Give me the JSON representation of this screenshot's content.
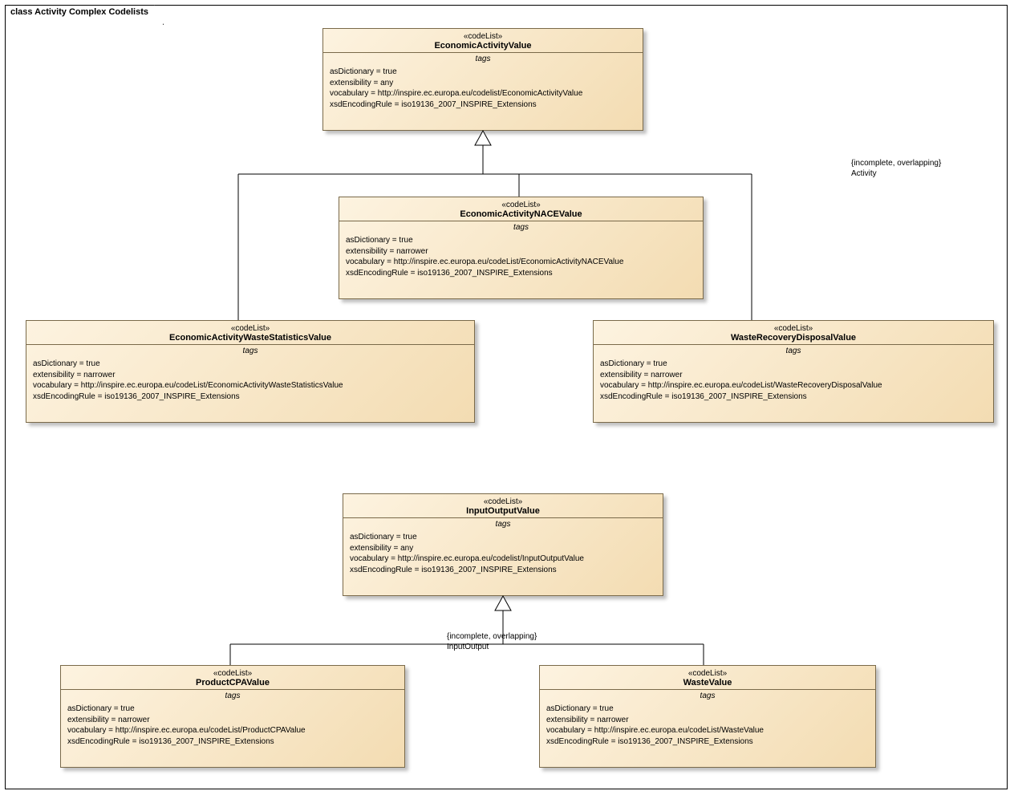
{
  "frame": {
    "title": "class Activity Complex Codelists"
  },
  "notes": {
    "top": {
      "line1": "{incomplete, overlapping}",
      "line2": "Activity"
    },
    "bottom": {
      "line1": "{incomplete, overlapping}",
      "line2": "InputOutput"
    }
  },
  "classes": {
    "economicActivityValue": {
      "stereotype": "«codeList»",
      "name": "EconomicActivityValue",
      "tagsLabel": "tags",
      "tags": "asDictionary = true\nextensibility = any\nvocabulary = http://inspire.ec.europa.eu/codelist/EconomicActivityValue\nxsdEncodingRule = iso19136_2007_INSPIRE_Extensions"
    },
    "economicActivityNACEValue": {
      "stereotype": "«codeList»",
      "name": "EconomicActivityNACEValue",
      "tagsLabel": "tags",
      "tags": "asDictionary = true\nextensibility = narrower\nvocabulary = http://inspire.ec.europa.eu/codeList/EconomicActivityNACEValue\nxsdEncodingRule = iso19136_2007_INSPIRE_Extensions"
    },
    "economicActivityWasteStatisticsValue": {
      "stereotype": "«codeList»",
      "name": "EconomicActivityWasteStatisticsValue",
      "tagsLabel": "tags",
      "tags": "asDictionary = true\nextensibility = narrower\nvocabulary = http://inspire.ec.europa.eu/codeList/EconomicActivityWasteStatisticsValue\nxsdEncodingRule = iso19136_2007_INSPIRE_Extensions"
    },
    "wasteRecoveryDisposalValue": {
      "stereotype": "«codeList»",
      "name": "WasteRecoveryDisposalValue",
      "tagsLabel": "tags",
      "tags": "asDictionary = true\nextensibility = narrower\nvocabulary = http://inspire.ec.europa.eu/codeList/WasteRecoveryDisposalValue\nxsdEncodingRule = iso19136_2007_INSPIRE_Extensions"
    },
    "inputOutputValue": {
      "stereotype": "«codeList»",
      "name": "InputOutputValue",
      "tagsLabel": "tags",
      "tags": "asDictionary = true\nextensibility = any\nvocabulary = http://inspire.ec.europa.eu/codelist/InputOutputValue\nxsdEncodingRule = iso19136_2007_INSPIRE_Extensions"
    },
    "productCPAValue": {
      "stereotype": "«codeList»",
      "name": "ProductCPAValue",
      "tagsLabel": "tags",
      "tags": "asDictionary = true\nextensibility = narrower\nvocabulary = http://inspire.ec.europa.eu/codeList/ProductCPAValue\nxsdEncodingRule = iso19136_2007_INSPIRE_Extensions"
    },
    "wasteValue": {
      "stereotype": "«codeList»",
      "name": "WasteValue",
      "tagsLabel": "tags",
      "tags": "asDictionary = true\nextensibility = narrower\nvocabulary = http://inspire.ec.europa.eu/codeList/WasteValue\nxsdEncodingRule = iso19136_2007_INSPIRE_Extensions"
    }
  }
}
